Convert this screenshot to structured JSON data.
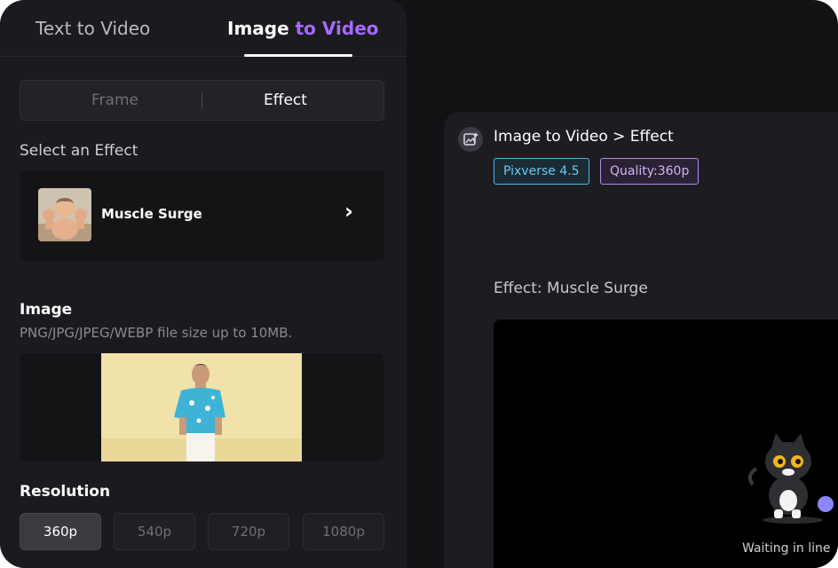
{
  "tabs": {
    "text_to_video": "Text to Video",
    "image_to_video_a": "Image ",
    "image_to_video_b": "to Video"
  },
  "mode": {
    "frame": "Frame",
    "effect": "Effect"
  },
  "effect_section": {
    "label": "Select an Effect",
    "selected_name": "Muscle Surge"
  },
  "image_section": {
    "label": "Image",
    "hint": "PNG/JPG/JPEG/WEBP file size up to 10MB."
  },
  "resolution": {
    "label": "Resolution",
    "options": [
      "360p",
      "540p",
      "720p",
      "1080p"
    ],
    "selected": "360p"
  },
  "preview": {
    "title": "Image to Video > Effect",
    "model_badge": "Pixverse 4.5",
    "quality_badge": "Quality:360p",
    "effect_line": "Effect: Muscle Surge",
    "status": "Waiting in line"
  },
  "colors": {
    "accent_purple": "#a46bff",
    "badge_blue": "#4fb9e8",
    "badge_purple": "#b78ee8",
    "background": "#121214",
    "panel": "#1b1b1f"
  },
  "icons": [
    "chevron-right-icon",
    "video-gen-icon",
    "cat-mascot-icon"
  ]
}
